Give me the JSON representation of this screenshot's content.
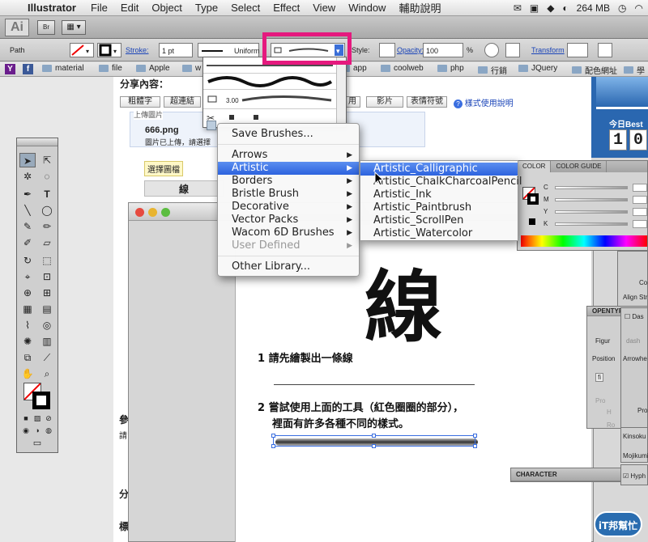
{
  "menubar": {
    "app_name": "Illustrator",
    "items": [
      "File",
      "Edit",
      "Object",
      "Type",
      "Select",
      "Effect",
      "View",
      "Window",
      "輔助說明"
    ],
    "memory": "264 MB"
  },
  "appbar": {
    "logo": "Ai",
    "bridge": "Br"
  },
  "control_bar": {
    "selection_label": "Path",
    "stroke_label": "Stroke:",
    "stroke_value": "1 pt",
    "profile_label": "Uniform",
    "style_label": "Style:",
    "opacity_label": "Opacity:",
    "opacity_value": "100",
    "percent": "%",
    "transform_label": "Transform"
  },
  "bookmarks": [
    "material",
    "file",
    "Apple",
    "w",
    "app",
    "coolweb",
    "php",
    "行銷",
    "JQuery",
    "配色網址",
    "學",
    "E"
  ],
  "webpage": {
    "share_title": "分享內容：",
    "format_buttons": [
      "粗體字",
      "超連結",
      "用",
      "影片",
      "表情符號"
    ],
    "help_link": "樣式使用說明",
    "upload_label": "上傳圖片",
    "file_name": "666.png",
    "upload_status": "圖片已上傳，請選擇",
    "choose_button": "選擇圖檔",
    "table_cell": "線",
    "today": "今日Best",
    "counter_digits": [
      "1",
      "0"
    ],
    "left_chars": [
      "參",
      "請",
      "分",
      "標"
    ]
  },
  "brush_dropdown": {
    "stroke_size": "3.00"
  },
  "brush_menu": {
    "save": "Save Brushes...",
    "items": [
      {
        "label": "Arrows",
        "sub": true,
        "disabled": false
      },
      {
        "label": "Artistic",
        "sub": true,
        "disabled": false
      },
      {
        "label": "Borders",
        "sub": true,
        "disabled": false
      },
      {
        "label": "Bristle Brush",
        "sub": true,
        "disabled": false
      },
      {
        "label": "Decorative",
        "sub": true,
        "disabled": false
      },
      {
        "label": "Vector Packs",
        "sub": true,
        "disabled": false
      },
      {
        "label": "Wacom 6D Brushes",
        "sub": true,
        "disabled": false
      },
      {
        "label": "User Defined",
        "sub": true,
        "disabled": true
      }
    ],
    "other": "Other Library...",
    "highlighted": "Artistic"
  },
  "submenu": {
    "items": [
      "Artistic_Calligraphic",
      "Artistic_ChalkCharcoalPencil",
      "Artistic_Ink",
      "Artistic_Paintbrush",
      "Artistic_ScrollPen",
      "Artistic_Watercolor"
    ],
    "highlighted": "Artistic_Calligraphic"
  },
  "color_panel": {
    "tabs": [
      "COLOR",
      "COLOR GUIDE"
    ],
    "channels": [
      "C",
      "M",
      "Y",
      "K"
    ]
  },
  "document": {
    "big_char": "線",
    "step1": "1  請先繪製出一條線",
    "step2_line1": "2  嘗試使用上面的工具（紅色圈圈的部分），",
    "step2_line2": "裡面有許多各種不同的樣式。"
  },
  "side_panels": {
    "opentype": "OPENTYP",
    "figure": "Figur",
    "position": "Position",
    "character": "CHARACTER",
    "kinsoku": "Kinsoku",
    "mojikumi": "Mojikumi",
    "hyph": "Hyph",
    "co": "Co",
    "align_stroke": "Align Str",
    "dash_check": "Das",
    "dash": "dash",
    "arrowhead": "Arrowhe",
    "pro": "Pro",
    "ro": "Ro",
    "h": "H",
    "fi": "fi"
  },
  "watermark": "iT邦幫忙",
  "colors": {
    "highlight": "#e5197e",
    "menu_highlight": "#2d63de",
    "link": "#1a44b8"
  }
}
